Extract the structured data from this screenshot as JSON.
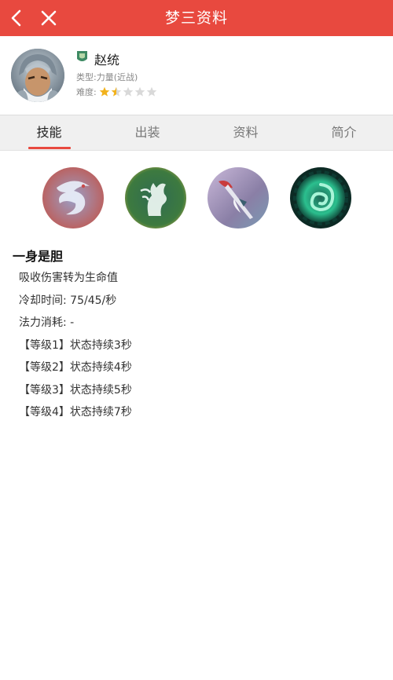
{
  "header": {
    "title": "梦三资料"
  },
  "hero": {
    "name": "赵统",
    "type_label": "类型:",
    "type_value": "力量(近战)",
    "difficulty_label": "难度:",
    "difficulty_rating": 1.5,
    "difficulty_max": 5
  },
  "tabs": [
    {
      "label": "技能",
      "active": true
    },
    {
      "label": "出装",
      "active": false
    },
    {
      "label": "资料",
      "active": false
    },
    {
      "label": "简介",
      "active": false
    }
  ],
  "skills": [
    {
      "icon": "dragon-skill-icon"
    },
    {
      "icon": "horse-skill-icon"
    },
    {
      "icon": "spear-skill-icon"
    },
    {
      "icon": "vortex-skill-icon"
    }
  ],
  "skill_detail": {
    "title": "一身是胆",
    "lines": [
      "吸收伤害转为生命值",
      "冷却时间: 75/45/秒",
      "法力消耗: -",
      "【等级1】状态持续3秒",
      "【等级2】状态持续4秒",
      "【等级3】状态持续5秒",
      "【等级4】状态持续7秒"
    ]
  },
  "colors": {
    "brand": "#e8493f",
    "star": "#f2b21c",
    "star_empty": "#d9d9d9"
  }
}
